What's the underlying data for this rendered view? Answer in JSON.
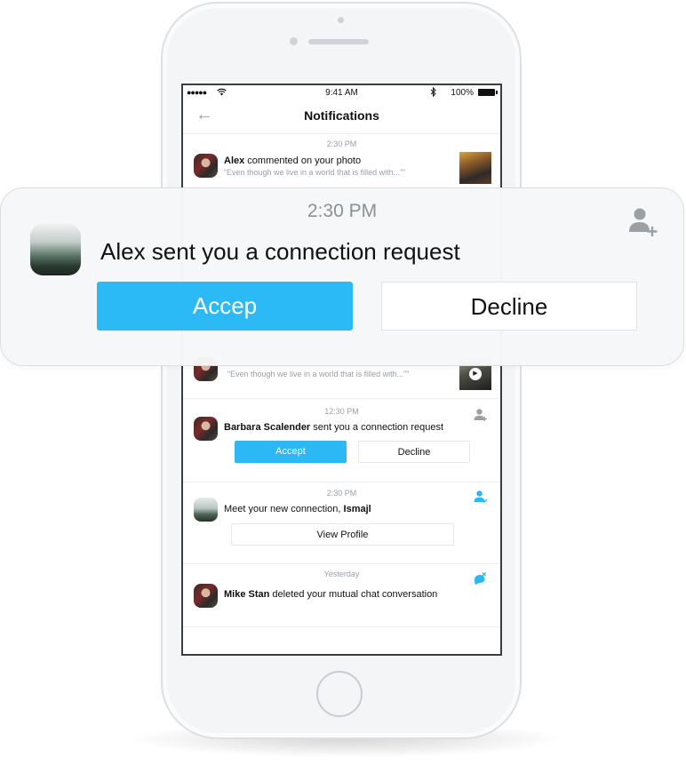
{
  "status_bar": {
    "signal": "●●●●●",
    "time": "9:41 AM",
    "battery": "100%"
  },
  "header": {
    "title": "Notifications",
    "back_icon": "←"
  },
  "notifications": [
    {
      "time": "2:30 PM",
      "name": "Alex",
      "text": " commented on your photo",
      "quote": "“Even though we live in a world that is filled with...””"
    },
    {
      "quote": "“Even though we live in a world that is filled with...””"
    },
    {
      "time": "12:30 PM",
      "name": "Barbara Scalender",
      "text": " sent you a connection request",
      "accept_label": "Accept",
      "decline_label": "Decline"
    },
    {
      "time": "2:30 PM",
      "text": "Meet your new connection, ",
      "name": "Ismajl",
      "view_label": "View Profile"
    },
    {
      "time": "Yesterday",
      "name": "Mike Stan",
      "text": " deleted your mutual chat conversation"
    }
  ],
  "popup": {
    "time": "2:30 PM",
    "message": "Alex sent you a connection request",
    "accept_label": "Accep",
    "decline_label": "Decline"
  },
  "colors": {
    "accent": "#2bb8f4",
    "icon_gray": "#9aa0a6"
  },
  "icons": {
    "add_user": "add-user-icon",
    "user_check": "user-check-icon",
    "chat_delete": "chat-delete-icon",
    "play": "play-icon"
  }
}
